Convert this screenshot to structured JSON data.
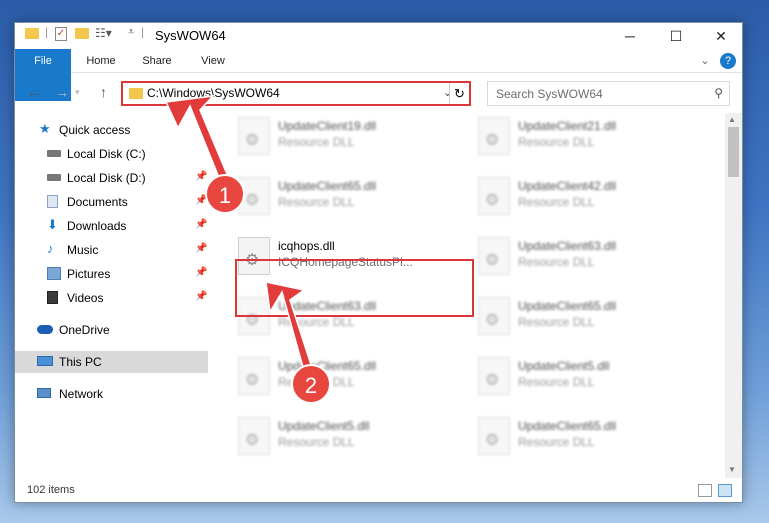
{
  "window": {
    "title": "SysWOW64",
    "controls": {
      "minimize": "─",
      "maximize": "☐",
      "close": "✕"
    }
  },
  "ribbon": {
    "tabs": [
      "File",
      "Home",
      "Share",
      "View"
    ],
    "expand": "⌄",
    "help": "?"
  },
  "address": {
    "path": "C:\\Windows\\SysWOW64",
    "search_placeholder": "Search SysWOW64"
  },
  "sidebar": {
    "items": [
      {
        "label": "Quick access",
        "icon": "star-icon"
      },
      {
        "label": "Local Disk (C:)",
        "icon": "drive-icon",
        "pinned": true
      },
      {
        "label": "Local Disk (D:)",
        "icon": "drive-icon",
        "pinned": true
      },
      {
        "label": "Documents",
        "icon": "documents-icon",
        "pinned": true
      },
      {
        "label": "Downloads",
        "icon": "downloads-icon",
        "pinned": true
      },
      {
        "label": "Music",
        "icon": "music-icon",
        "pinned": true
      },
      {
        "label": "Pictures",
        "icon": "pictures-icon",
        "pinned": true
      },
      {
        "label": "Videos",
        "icon": "videos-icon",
        "pinned": true
      },
      {
        "label": "OneDrive",
        "icon": "cloud-icon"
      },
      {
        "label": "This PC",
        "icon": "pc-icon",
        "selected": true
      },
      {
        "label": "Network",
        "icon": "network-icon"
      }
    ]
  },
  "files": [
    {
      "name": "UpdateClient19.dll",
      "desc": "Resource DLL"
    },
    {
      "name": "UpdateClient21.dll",
      "desc": "Resource DLL"
    },
    {
      "name": "UpdateClient65.dll",
      "desc": "Resource DLL"
    },
    {
      "name": "UpdateClient42.dll",
      "desc": "Resource DLL"
    },
    {
      "name": "icqhops.dll",
      "desc": "ICQHomepageStatusPl..."
    },
    {
      "name": "UpdateClient63.dll",
      "desc": "Resource DLL"
    },
    {
      "name": "UpdateClient63.dll",
      "desc": "Resource DLL"
    },
    {
      "name": "UpdateClient65.dll",
      "desc": "Resource DLL"
    },
    {
      "name": "UpdateClient65.dll",
      "desc": "Resource DLL"
    },
    {
      "name": "UpdateClient5.dll",
      "desc": "Resource DLL"
    },
    {
      "name": "UpdateClient5.dll",
      "desc": "Resource DLL"
    },
    {
      "name": "UpdateClient65.dll",
      "desc": "Resource DLL"
    }
  ],
  "status": {
    "item_count": "102 items"
  },
  "callouts": {
    "one": "1",
    "two": "2"
  },
  "colors": {
    "accent": "#1979ca",
    "highlight": "#d9383a",
    "callout": "#e8473f"
  }
}
